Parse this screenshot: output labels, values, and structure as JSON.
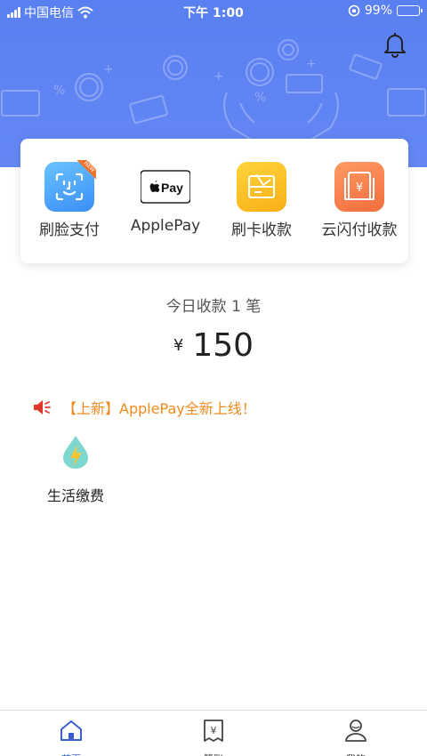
{
  "status_bar": {
    "carrier": "中国电信",
    "time": "下午 1:00",
    "battery": "99%",
    "battery_level": 0.99
  },
  "functions": [
    {
      "label": "刷脸支付",
      "icon": "face-id-icon",
      "badge": "NEW"
    },
    {
      "label": "ApplePay",
      "icon": "apple-pay-icon",
      "logo_text": "Pay"
    },
    {
      "label": "刷卡收款",
      "icon": "card-swipe-icon"
    },
    {
      "label": "云闪付收款",
      "icon": "yun-flash-pay-icon",
      "symbol": "¥"
    }
  ],
  "summary": {
    "today_label": "今日收款 1 笔",
    "currency": "¥",
    "amount": "150"
  },
  "notice": {
    "icon": "speaker-icon",
    "text": "【上新】ApplePay全新上线！"
  },
  "services": [
    {
      "label": "生活缴费",
      "icon": "utility-bill-icon"
    }
  ],
  "tabbar": [
    {
      "label": "首页",
      "icon": "home-icon",
      "active": true
    },
    {
      "label": "管账",
      "icon": "ledger-icon",
      "symbol": "¥",
      "active": false
    },
    {
      "label": "我的",
      "icon": "profile-icon",
      "active": false
    }
  ],
  "colors": {
    "header_blue": "#5a7ff0",
    "accent_blue": "#4068e4",
    "notice_orange": "#f08a1c",
    "speaker_red": "#e0362c"
  }
}
